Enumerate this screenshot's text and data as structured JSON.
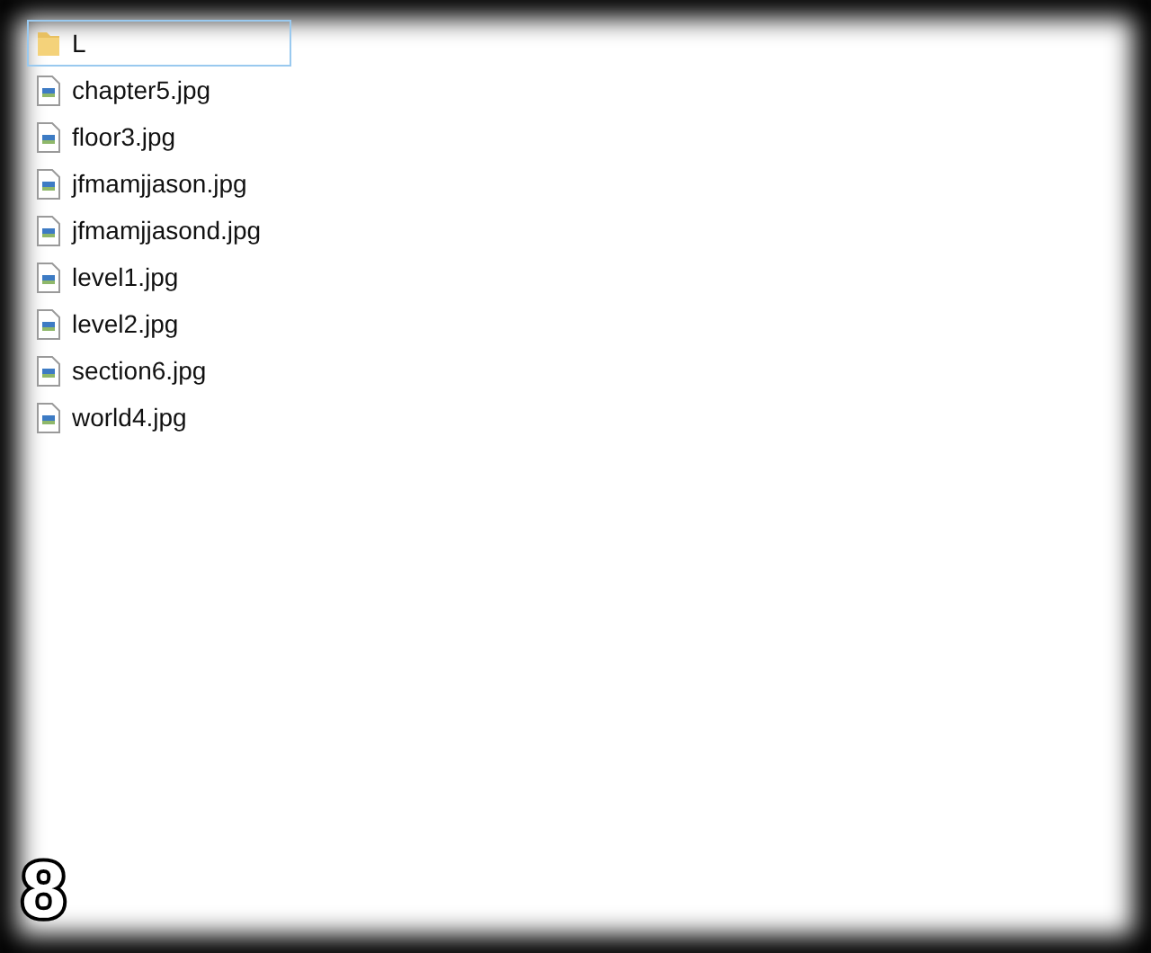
{
  "items": [
    {
      "kind": "folder",
      "name": "L",
      "focused": true
    },
    {
      "kind": "image",
      "name": "chapter5.jpg",
      "focused": false
    },
    {
      "kind": "image",
      "name": "floor3.jpg",
      "focused": false
    },
    {
      "kind": "image",
      "name": "jfmamjjason.jpg",
      "focused": false
    },
    {
      "kind": "image",
      "name": "jfmamjjasond.jpg",
      "focused": false
    },
    {
      "kind": "image",
      "name": "level1.jpg",
      "focused": false
    },
    {
      "kind": "image",
      "name": "level2.jpg",
      "focused": false
    },
    {
      "kind": "image",
      "name": "section6.jpg",
      "focused": false
    },
    {
      "kind": "image",
      "name": "world4.jpg",
      "focused": false
    }
  ],
  "corner_number": "8"
}
